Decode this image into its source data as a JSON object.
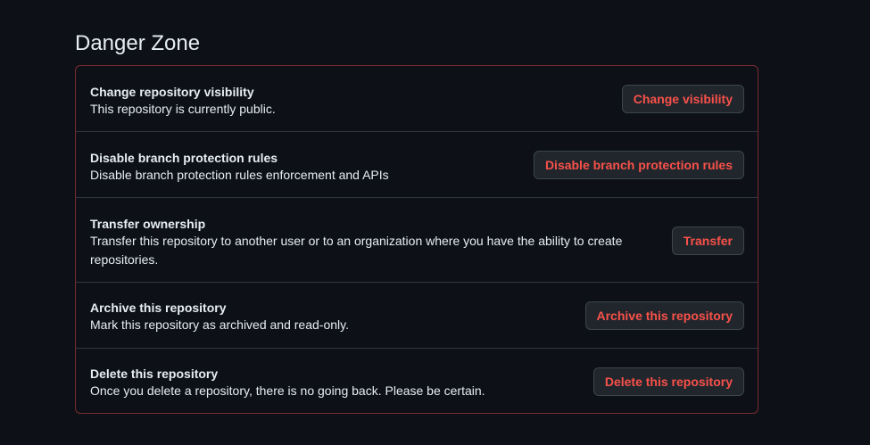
{
  "heading": "Danger Zone",
  "rows": [
    {
      "title": "Change repository visibility",
      "description": "This repository is currently public.",
      "button": "Change visibility"
    },
    {
      "title": "Disable branch protection rules",
      "description": "Disable branch protection rules enforcement and APIs",
      "button": "Disable branch protection rules"
    },
    {
      "title": "Transfer ownership",
      "description": "Transfer this repository to another user or to an organization where you have the ability to create repositories.",
      "button": "Transfer"
    },
    {
      "title": "Archive this repository",
      "description": "Mark this repository as archived and read-only.",
      "button": "Archive this repository"
    },
    {
      "title": "Delete this repository",
      "description": "Once you delete a repository, there is no going back. Please be certain.",
      "button": "Delete this repository"
    }
  ],
  "colors": {
    "background": "#0d1117",
    "danger_border": "#7a2a2e",
    "danger_text": "#f85149",
    "button_bg": "#21262d"
  }
}
